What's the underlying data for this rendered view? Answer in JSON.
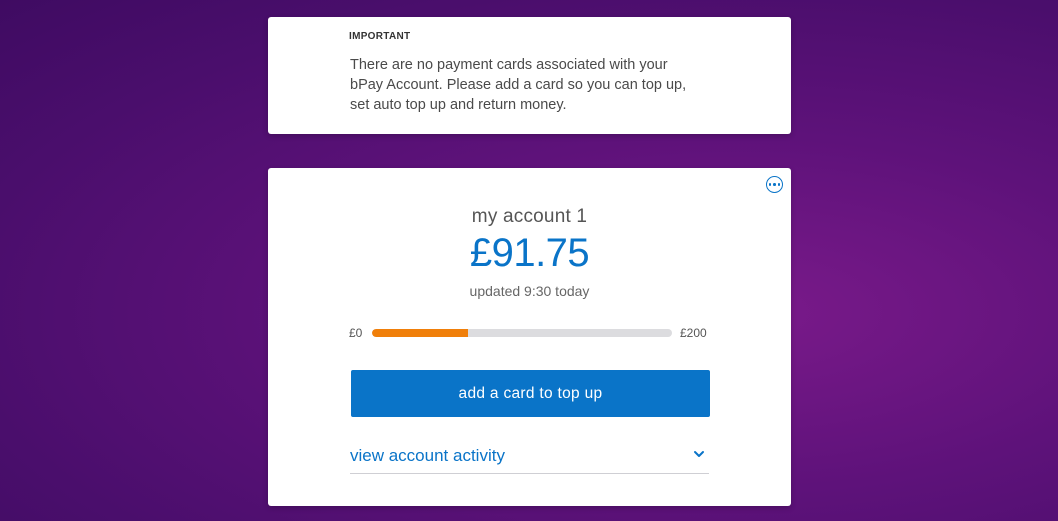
{
  "notice": {
    "heading": "IMPORTANT",
    "line1": "There are no payment cards associated with your",
    "line2": "bPay Account. Please add a card so you can top up,",
    "line3": "set auto top up and return money."
  },
  "account": {
    "name": "my account 1",
    "balance": "£91.75",
    "updated": "updated 9:30 today",
    "range_min": "£0",
    "range_max": "£200",
    "progress_fraction": 0.32,
    "add_card_label": "add a card to top up",
    "activity_label": "view account activity"
  },
  "icons": {
    "more": "more-options-icon",
    "activity_toggle": "chevron-down-icon"
  },
  "colors": {
    "accent": "#0a74c8",
    "progress": "#f07f0a",
    "track": "#dcdcdf"
  }
}
